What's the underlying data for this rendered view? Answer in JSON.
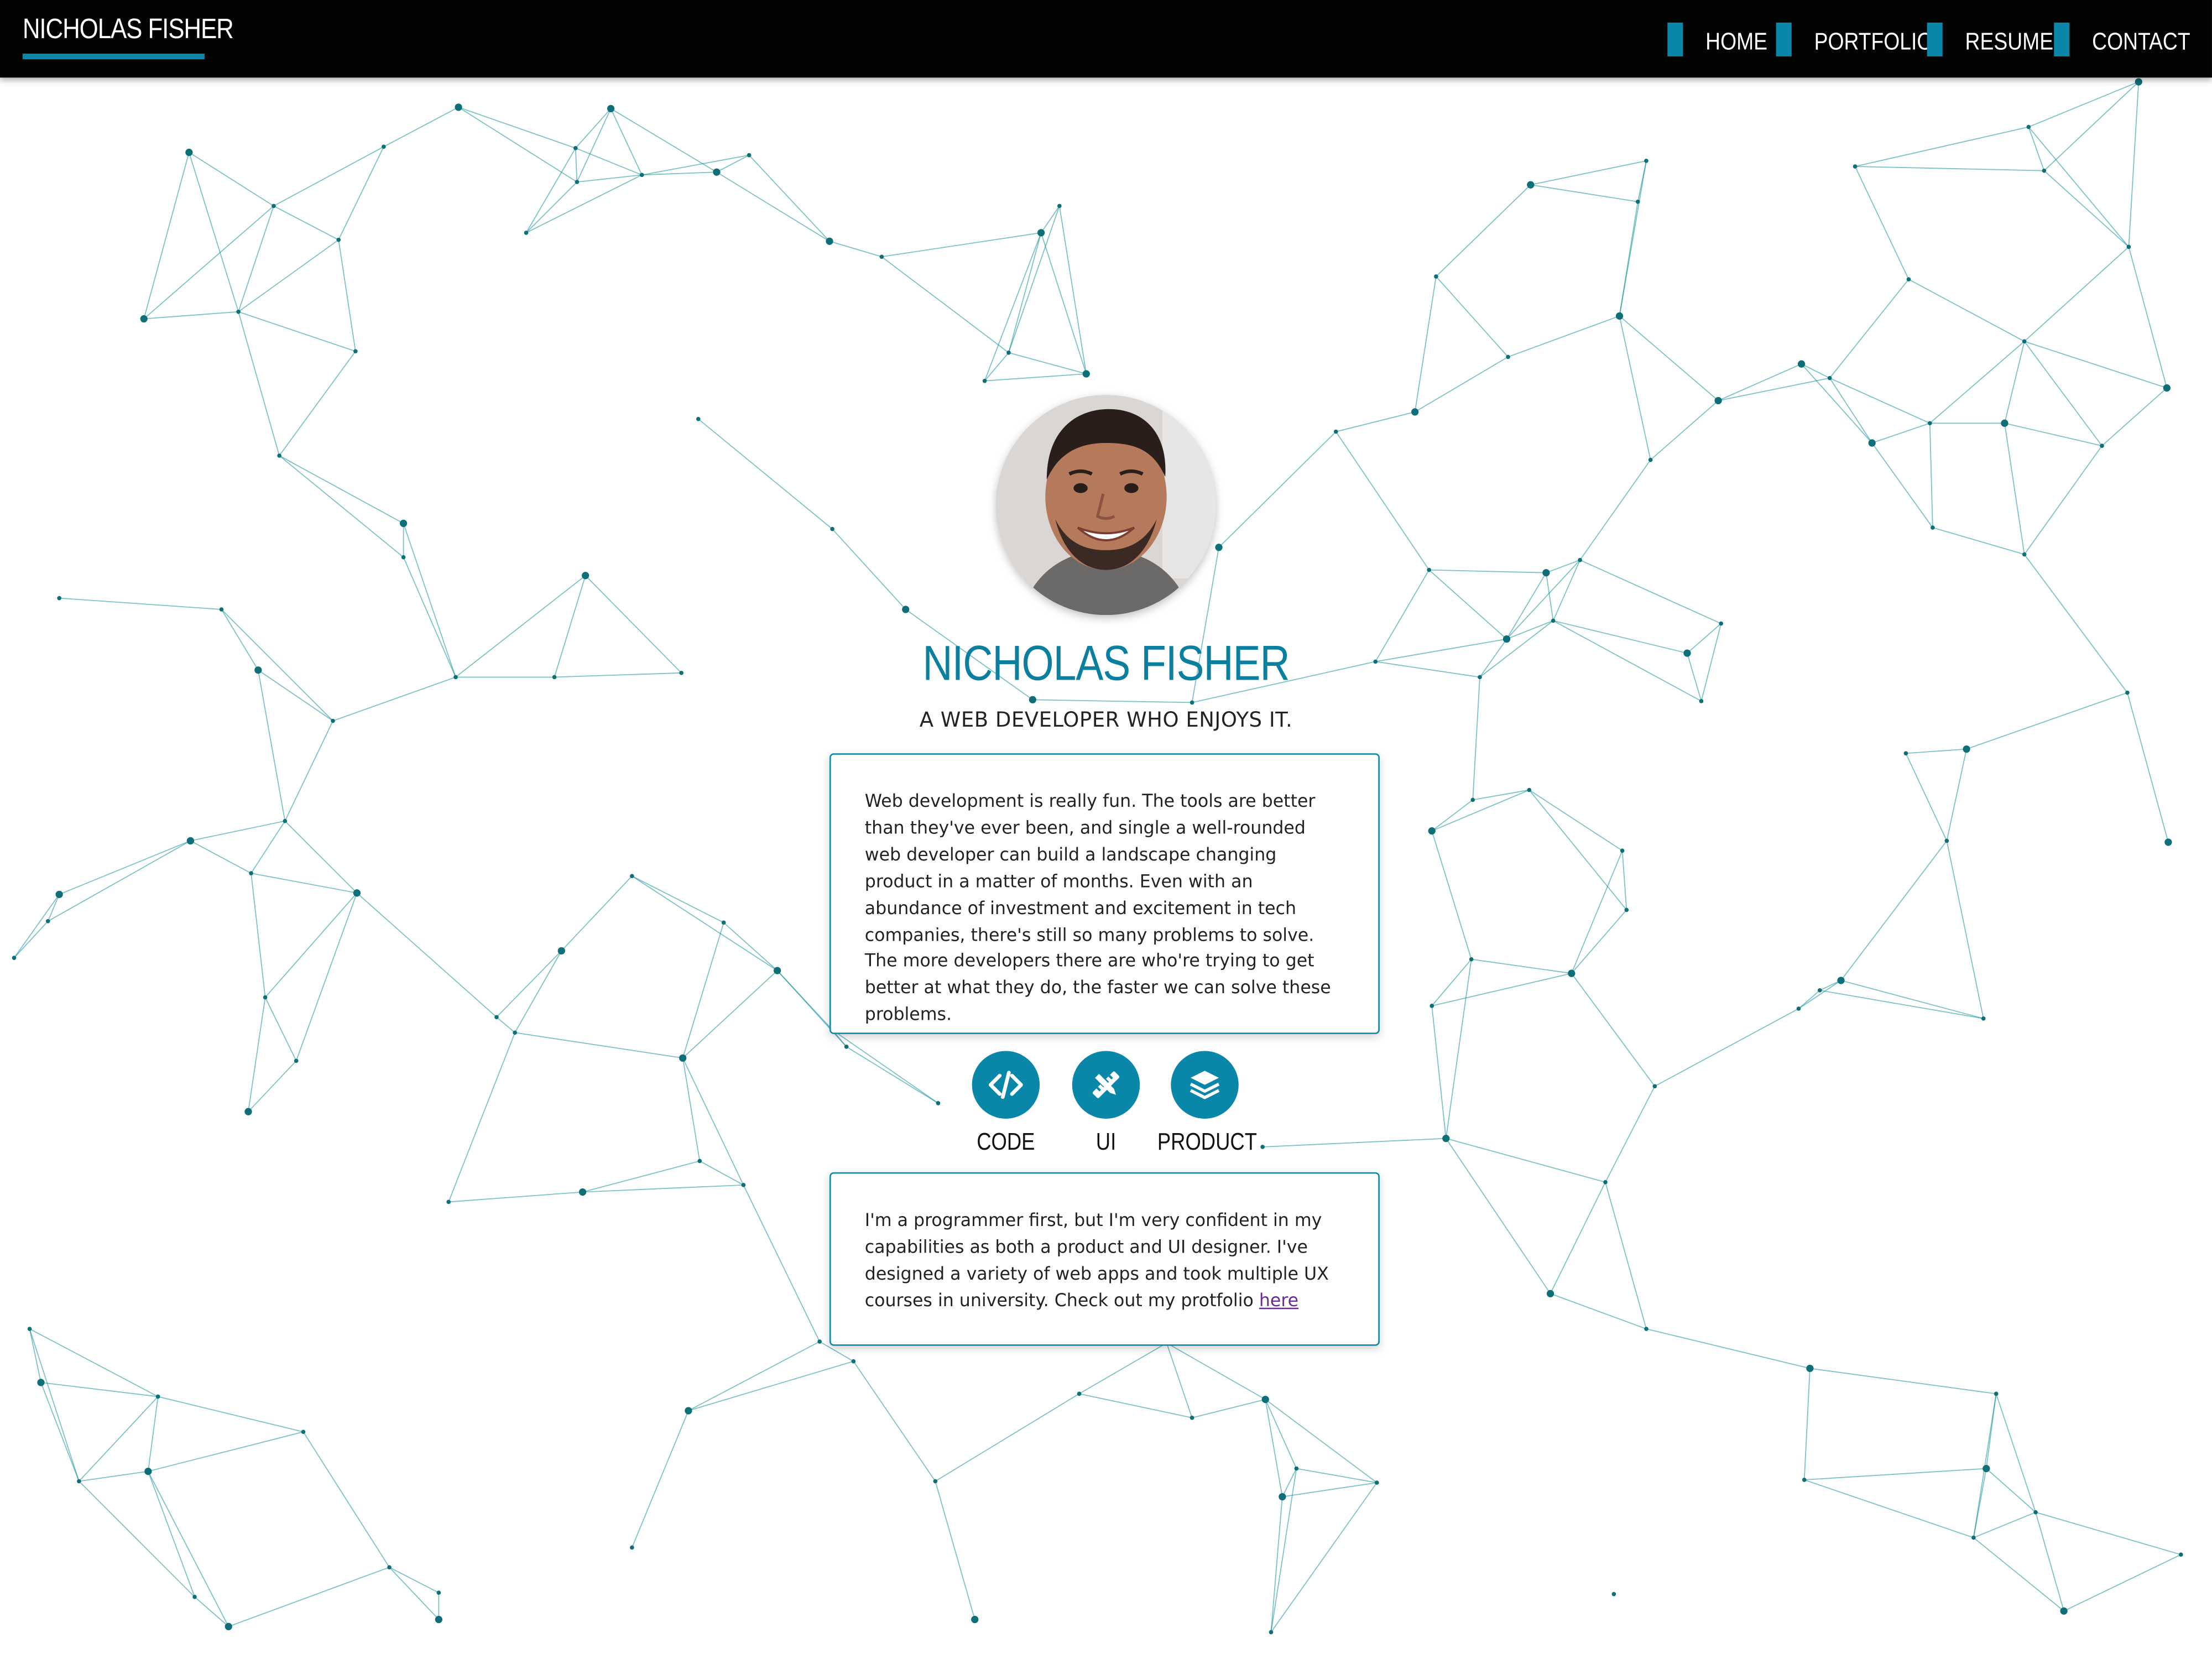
{
  "brand": "NICHOLAS FISHER",
  "colors": {
    "accent": "#0a86a8",
    "navbar": "#030303",
    "network": "#0f7f87",
    "link": "#6a2b96"
  },
  "nav": {
    "items": [
      {
        "label": "HOME"
      },
      {
        "label": "PORTFOLIO"
      },
      {
        "label": "RESUME"
      },
      {
        "label": "CONTACT"
      }
    ]
  },
  "hero": {
    "avatar_alt": "profile-photo",
    "name": "NICHOLAS FISHER",
    "tagline": "A WEB DEVELOPER WHO ENJOYS IT."
  },
  "about": {
    "text": "Web development is really fun. The tools are better than they've ever been, and single a well-rounded web developer can build a landscape changing product in a matter of months. Even with an abundance of investment and excitement in tech companies, there's still so many problems to solve. The more developers there are who're trying to get better at what they do, the faster we can solve these problems."
  },
  "skills": [
    {
      "label": "CODE",
      "icon": "code-icon"
    },
    {
      "label": "UI",
      "icon": "design-tools-icon"
    },
    {
      "label": "PRODUCT",
      "icon": "layers-icon"
    }
  ],
  "portfolio_blurb": {
    "text": "I'm a programmer first, but I'm very confident in my capabilities as both a product and UI designer. I've designed a variety of web apps and took multiple UX courses in university. Check out my protfolio ",
    "link_text": "here"
  }
}
